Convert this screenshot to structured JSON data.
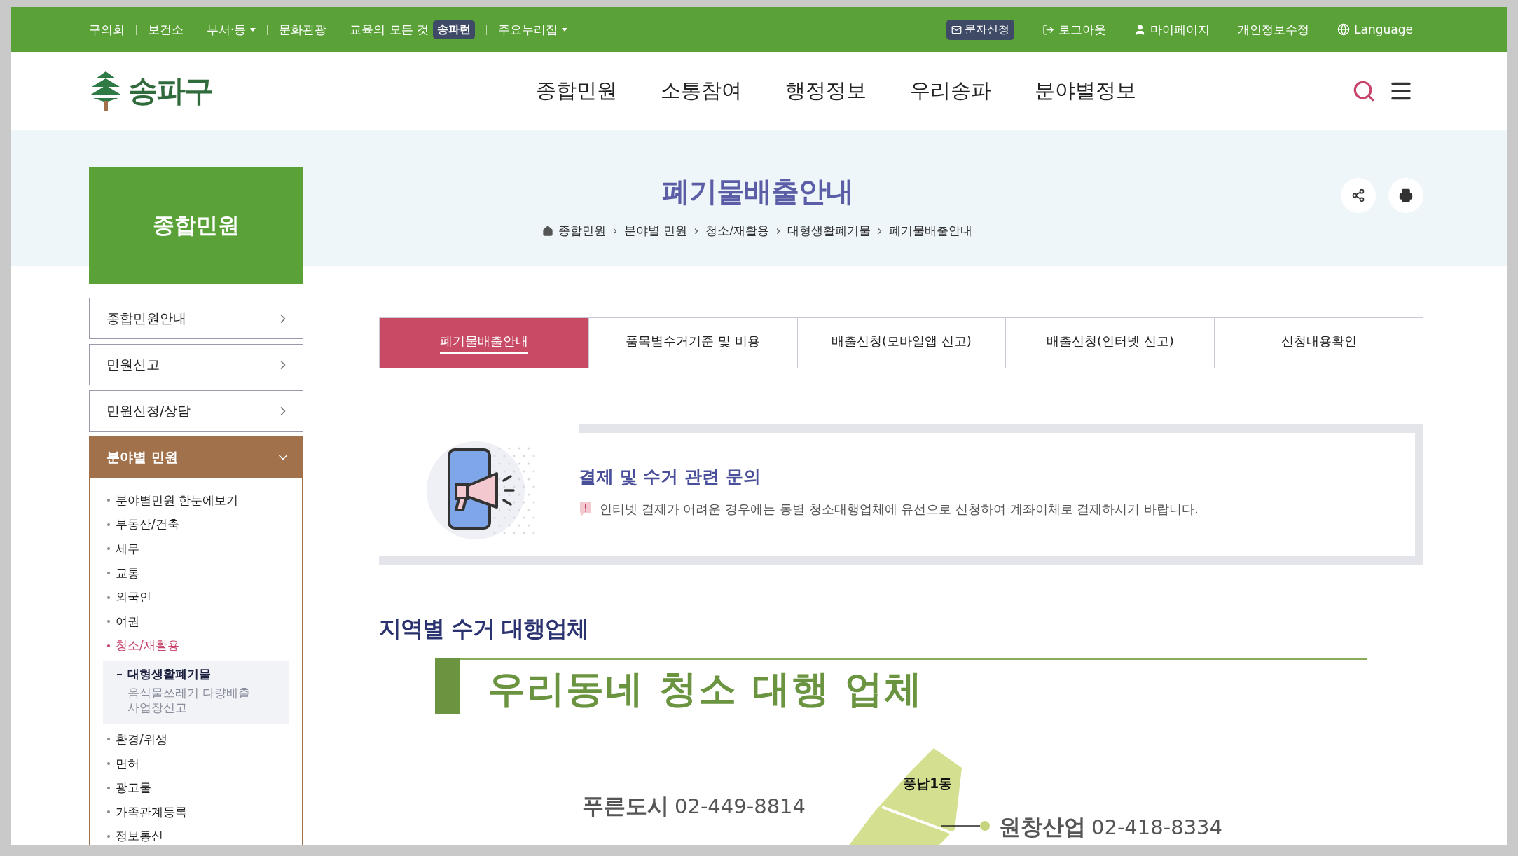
{
  "top_bar": {
    "left_links": [
      {
        "label": "구의회",
        "dropdown": false
      },
      {
        "label": "보건소",
        "dropdown": false
      },
      {
        "label": "부서·동",
        "dropdown": true
      },
      {
        "label": "문화관광",
        "dropdown": false
      },
      {
        "label": "교육의 모든 것",
        "badge": "송파런",
        "dropdown": false
      },
      {
        "label": "주요누리집",
        "dropdown": true
      }
    ],
    "right_links": [
      {
        "label": "문자신청",
        "kind": "sms"
      },
      {
        "label": "로그아웃",
        "kind": "logout"
      },
      {
        "label": "마이페이지",
        "kind": "mypage"
      },
      {
        "label": "개인정보수정",
        "kind": "plain"
      },
      {
        "label": "Language",
        "kind": "language"
      }
    ]
  },
  "header": {
    "logo": "송파구",
    "nav": [
      "종합민원",
      "소통참여",
      "행정정보",
      "우리송파",
      "분야별정보"
    ]
  },
  "page": {
    "title": "폐기물배출안내",
    "breadcrumb": [
      "종합민원",
      "분야별 민원",
      "청소/재활용",
      "대형생활폐기물",
      "폐기물배출안내"
    ]
  },
  "sidebar": {
    "title": "종합민원",
    "menu": [
      {
        "label": "종합민원안내",
        "expanded": false
      },
      {
        "label": "민원신고",
        "expanded": false
      },
      {
        "label": "민원신청/상담",
        "expanded": false
      },
      {
        "label": "분야별 민원",
        "expanded": true,
        "children": [
          {
            "label": "분야별민원 한눈에보기",
            "selected": false
          },
          {
            "label": "부동산/건축",
            "selected": false
          },
          {
            "label": "세무",
            "selected": false
          },
          {
            "label": "교통",
            "selected": false
          },
          {
            "label": "외국인",
            "selected": false
          },
          {
            "label": "여권",
            "selected": false
          },
          {
            "label": "청소/재활용",
            "selected": true,
            "children": [
              {
                "label": "대형생활폐기물",
                "selected": true
              },
              {
                "label": "음식물쓰레기 다량배출 사업장신고",
                "selected": false
              }
            ]
          },
          {
            "label": "환경/위생",
            "selected": false
          },
          {
            "label": "면허",
            "selected": false
          },
          {
            "label": "광고물",
            "selected": false
          },
          {
            "label": "가족관계등록",
            "selected": false
          },
          {
            "label": "정보통신",
            "selected": false
          }
        ]
      }
    ]
  },
  "tabs": [
    {
      "label": "폐기물배출안내",
      "selected": true
    },
    {
      "label": "품목별수거기준 및 비용",
      "selected": false
    },
    {
      "label": "배출신청(모바일앱 신고)",
      "selected": false
    },
    {
      "label": "배출신청(인터넷 신고)",
      "selected": false
    },
    {
      "label": "신청내용확인",
      "selected": false
    }
  ],
  "notice": {
    "title": "결제 및 수거 관련 문의",
    "text": "인터넷 결제가 어려운 경우에는 동별 청소대행업체에 유선으로 신청하여 계좌이체로 결제하시기 바랍니다."
  },
  "section_title": "지역별 수거 대행업체",
  "infographic": {
    "title": "우리동네 청소 대행 업체",
    "areas": [
      "풍납1동"
    ],
    "companies": [
      {
        "name": "푸른도시",
        "phone": "02-449-8814"
      },
      {
        "name": "원창산업",
        "phone": "02-418-8334"
      }
    ]
  }
}
